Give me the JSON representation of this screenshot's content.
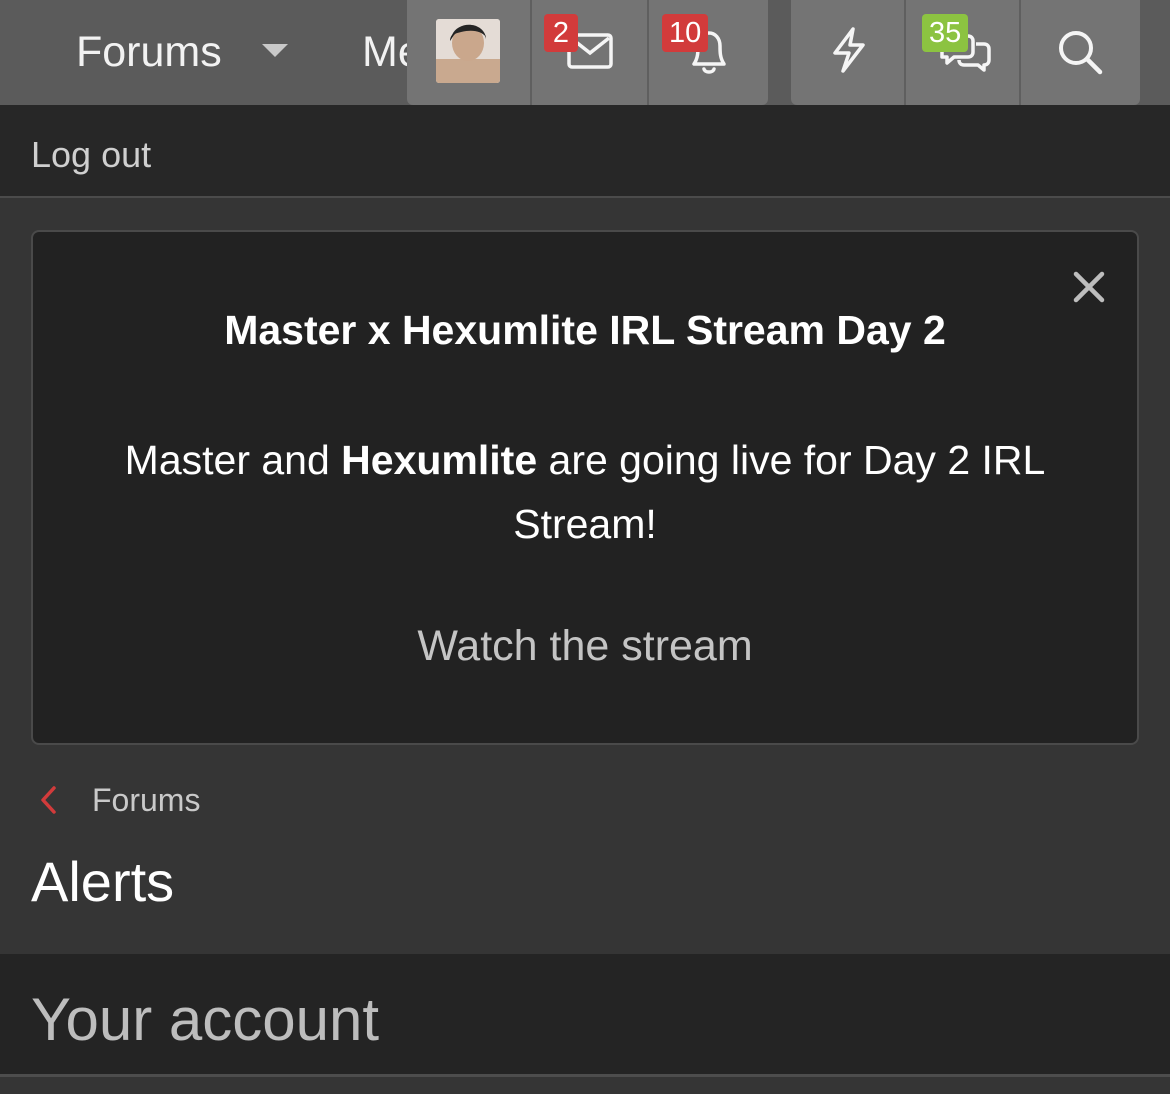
{
  "nav": {
    "forums_label": "Forums",
    "members_label": "Me",
    "badges": {
      "conversations": "2",
      "alerts": "10",
      "unread": "35"
    },
    "icons": [
      "avatar",
      "envelope-icon",
      "bell-icon",
      "lightning-icon",
      "chat-bubbles-icon",
      "search-icon"
    ]
  },
  "account_bar": {
    "logout_label": "Log out"
  },
  "notice": {
    "title": "Master x Hexumlite IRL Stream Day 2",
    "body_prefix": "Master and ",
    "body_bold": "Hexumlite",
    "body_suffix": " are going live for Day 2 IRL Stream!",
    "link_label": "Watch the stream"
  },
  "breadcrumb": {
    "label": "Forums"
  },
  "page": {
    "title": "Alerts"
  },
  "section": {
    "title": "Your account"
  },
  "colors": {
    "accent": "#d23b3b",
    "green_badge": "#8cc341",
    "nav_bg": "#5b5b5b",
    "page_bg": "#353535"
  }
}
